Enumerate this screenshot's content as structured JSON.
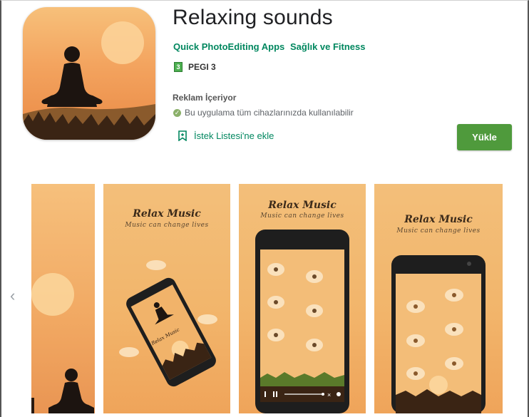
{
  "app": {
    "title": "Relaxing sounds",
    "developer": "Quick PhotoEditing Apps",
    "category": "Sağlık ve Fitness",
    "rating_badge": "3",
    "rating_label": "PEGI 3",
    "ads_label": "Reklam İçeriyor",
    "compat_text": "Bu uygulama tüm cihazlarınızda kullanılabilir",
    "wishlist_label": "İstek Listesi'ne ekle",
    "install_label": "Yükle"
  },
  "colors": {
    "accent_green": "#01875f",
    "install_button": "#4f9a3c",
    "orange_light": "#f3bf7a",
    "orange_dark": "#e98945"
  },
  "screenshots": {
    "prev_icon": "chevron-left-icon",
    "shot2": {
      "title": "Relax Music",
      "subtitle": "Music can change lives",
      "phone_title": "Relax Music"
    },
    "shot3": {
      "title": "Relax Music",
      "subtitle": "Music can change lives"
    },
    "shot4": {
      "title": "Relax Music",
      "subtitle": "Music can change lives"
    }
  }
}
